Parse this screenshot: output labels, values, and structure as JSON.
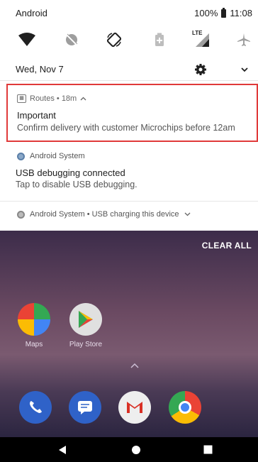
{
  "status_bar": {
    "carrier": "Android",
    "battery_percent": "100%",
    "time": "11:08"
  },
  "quick_settings": {
    "icons": [
      "wifi-icon",
      "do-not-disturb-off-icon",
      "auto-rotate-icon",
      "battery-saver-icon",
      "lte-signal-icon",
      "airplane-mode-icon"
    ],
    "lte_label": "LTE"
  },
  "date_row": {
    "date": "Wed, Nov 7"
  },
  "notifications": {
    "routes": {
      "app_name": "Routes",
      "time_ago": "18m",
      "header": "Routes • 18m",
      "title": "Important",
      "body": "Confirm delivery with customer Microchips before 12am",
      "highlight_color": "#e03a3a"
    },
    "usb_debugging": {
      "app_name": "Android System",
      "title": "USB debugging connected",
      "body": "Tap to disable USB debugging."
    },
    "usb_charging": {
      "text": "Android System • USB charging this device"
    }
  },
  "clear_all_label": "CLEAR ALL",
  "home_screen": {
    "apps": [
      {
        "label": "Maps"
      },
      {
        "label": "Play Store"
      }
    ],
    "dock": [
      "phone-icon",
      "messages-icon",
      "gmail-icon",
      "chrome-icon"
    ]
  },
  "nav_bar": [
    "back-button",
    "home-button",
    "recents-button"
  ]
}
